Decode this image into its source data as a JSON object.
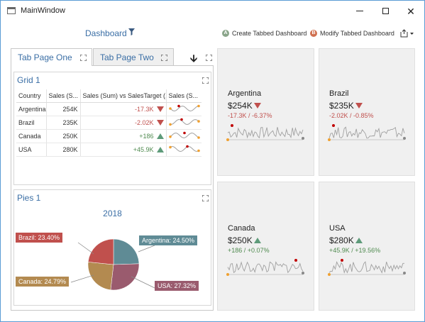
{
  "window": {
    "title": "MainWindow"
  },
  "toolbar": {
    "dashboard_title": "Dashboard",
    "create_label": "Create Tabbed Dashboard",
    "create_badge": "A",
    "modify_label": "Modify Tabbed Dashboard",
    "modify_badge": "B"
  },
  "tabs": [
    {
      "label": "Tab Page One",
      "active": true
    },
    {
      "label": "Tab Page Two",
      "active": false
    }
  ],
  "grid": {
    "title": "Grid 1",
    "columns": [
      "Country",
      "Sales (S...",
      "Sales (Sum) vs SalesTarget (...",
      "Sales (S..."
    ],
    "rows": [
      {
        "country": "Argentina",
        "sales": "254K",
        "delta": "-17.3K",
        "trend": "down"
      },
      {
        "country": "Brazil",
        "sales": "235K",
        "delta": "-2.02K",
        "trend": "down"
      },
      {
        "country": "Canada",
        "sales": "250K",
        "delta": "+186",
        "trend": "up"
      },
      {
        "country": "USA",
        "sales": "280K",
        "delta": "+45.9K",
        "trend": "up"
      }
    ]
  },
  "pies": {
    "title": "Pies 1",
    "year": "2018",
    "slices": [
      {
        "label": "Argentina: 24.50%",
        "value": 24.5,
        "color": "#5f8b95"
      },
      {
        "label": "USA: 27.32%",
        "value": 27.32,
        "color": "#9a5b6e"
      },
      {
        "label": "Canada: 24.79%",
        "value": 24.79,
        "color": "#b38a50"
      },
      {
        "label": "Brazil: 23.40%",
        "value": 23.4,
        "color": "#c0504d"
      }
    ]
  },
  "kpis": [
    {
      "name": "Argentina",
      "value": "$254K",
      "trend": "down",
      "delta": "-17.3K",
      "percent": "-6.37%"
    },
    {
      "name": "Brazil",
      "value": "$235K",
      "trend": "down",
      "delta": "-2.02K",
      "percent": "-0.85%"
    },
    {
      "name": "Canada",
      "value": "$250K",
      "trend": "up",
      "delta": "+186",
      "percent": "+0.07%"
    },
    {
      "name": "USA",
      "value": "$280K",
      "trend": "up",
      "delta": "+45.9K",
      "percent": "+19.56%"
    }
  ],
  "colors": {
    "accent": "#3a6ea5",
    "negative": "#c0504d",
    "positive": "#4f8a4f",
    "spark_line": "#a0a0a0",
    "spark_start": "#f0a030",
    "spark_max": "#c00000"
  },
  "icons": [
    "filter-icon",
    "maximize-icon",
    "arrow-down-icon",
    "export-icon",
    "minimize-icon",
    "close-icon"
  ]
}
